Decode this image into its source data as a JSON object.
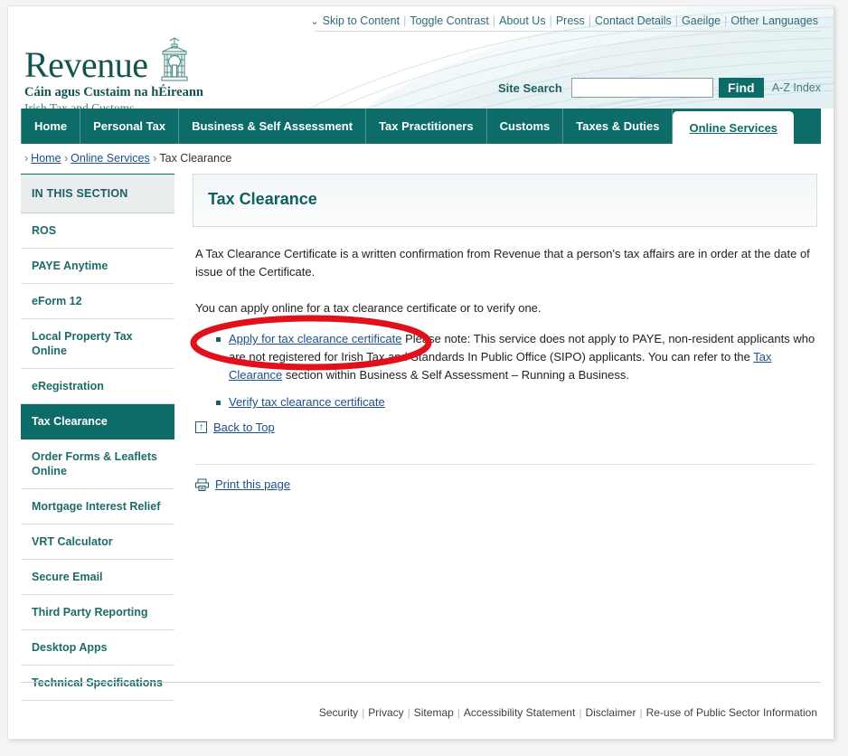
{
  "header": {
    "top_links": [
      "Skip to Content",
      "Toggle Contrast",
      "About Us",
      "Press",
      "Contact Details",
      "Gaeilge",
      "Other Languages"
    ],
    "logo": {
      "wordmark": "Revenue",
      "irish_tagline": "Cáin agus Custaim na hÉireann",
      "english_tagline": "Irish Tax and Customs",
      "emblem_icon": "revenue-building-emblem"
    },
    "search": {
      "label": "Site Search",
      "value": "",
      "placeholder": "",
      "button_label": "Find",
      "az_index_label": "A-Z Index"
    }
  },
  "nav": {
    "items": [
      {
        "label": "Home",
        "active": false
      },
      {
        "label": "Personal Tax",
        "active": false
      },
      {
        "label": "Business & Self Assessment",
        "active": false
      },
      {
        "label": "Tax Practitioners",
        "active": false
      },
      {
        "label": "Customs",
        "active": false
      },
      {
        "label": "Taxes & Duties",
        "active": false
      },
      {
        "label": "Online Services",
        "active": true
      }
    ]
  },
  "breadcrumb": {
    "items": [
      {
        "label": "Home",
        "link": true
      },
      {
        "label": "Online Services",
        "link": true
      },
      {
        "label": "Tax Clearance",
        "link": false
      }
    ]
  },
  "sidebar": {
    "header": "IN THIS SECTION",
    "items": [
      {
        "label": "ROS",
        "active": false
      },
      {
        "label": "PAYE Anytime",
        "active": false
      },
      {
        "label": "eForm 12",
        "active": false
      },
      {
        "label": "Local Property Tax Online",
        "active": false
      },
      {
        "label": "eRegistration",
        "active": false
      },
      {
        "label": "Tax Clearance",
        "active": true
      },
      {
        "label": "Order Forms & Leaflets Online",
        "active": false
      },
      {
        "label": "Mortgage Interest Relief",
        "active": false
      },
      {
        "label": "VRT Calculator",
        "active": false
      },
      {
        "label": "Secure Email",
        "active": false
      },
      {
        "label": "Third Party Reporting",
        "active": false
      },
      {
        "label": "Desktop Apps",
        "active": false
      },
      {
        "label": "Technical Specifications",
        "active": false
      }
    ]
  },
  "main": {
    "title": "Tax Clearance",
    "paragraph_1": "A Tax Clearance Certificate is a written confirmation from Revenue that a person's tax affairs are in order at the date of issue of the Certificate.",
    "paragraph_2": "You can apply online for a tax clearance certificate or to verify one.",
    "bullet_1": {
      "link_label": "Apply for tax clearance certificate",
      "note_before": " Please note: This service does not apply to PAYE, non-resident applicants who are not registered for Irish Tax and Standards In Public Office (SIPO) applicants. You can refer to the ",
      "inline_link_label": "Tax Clearance",
      "note_after": " section within Business & Self Assessment – Running a Business."
    },
    "bullet_2": {
      "link_label": "Verify tax clearance certificate"
    },
    "back_to_top": {
      "label": "Back to Top",
      "icon": "up-arrow-box-icon"
    },
    "print": {
      "label": "Print this page",
      "icon": "printer-icon"
    }
  },
  "footer": {
    "links": [
      "Security",
      "Privacy",
      "Sitemap",
      "Accessibility Statement",
      "Disclaimer",
      "Re-use of Public Sector Information"
    ]
  },
  "annotation": {
    "type": "ellipse-highlight",
    "color": "#e2101a",
    "target": "Apply for tax clearance certificate"
  },
  "colors": {
    "brand_teal": "#0d6b68",
    "heading_teal": "#0f5e61",
    "link_blue": "#1c4f8c",
    "annotation_red": "#e2101a"
  }
}
